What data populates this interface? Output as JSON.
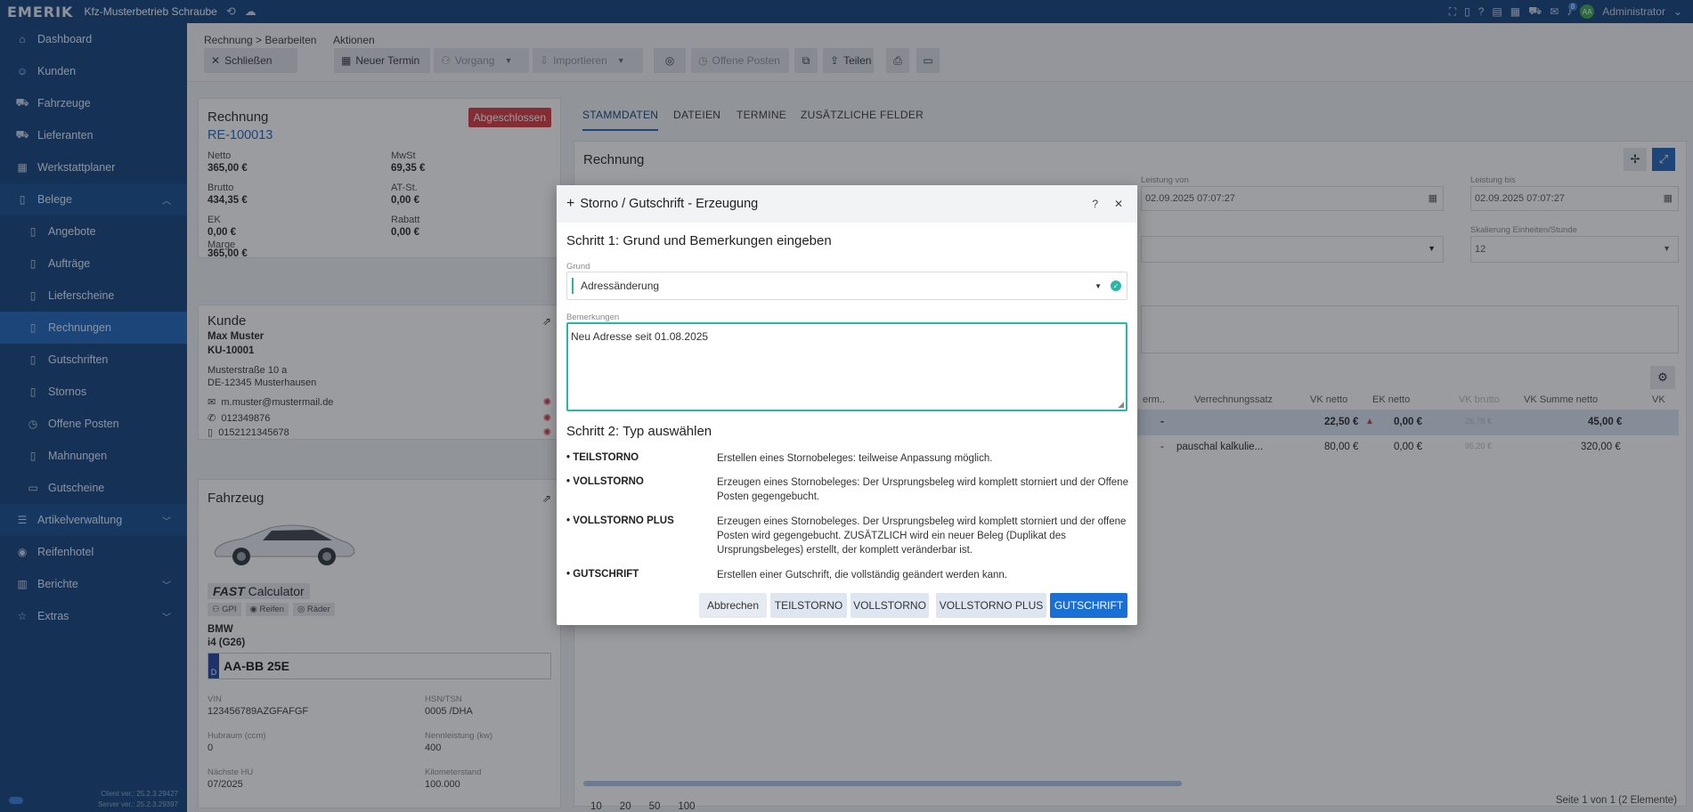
{
  "topbar": {
    "logo": "EMERIK",
    "company": "Kfz-Musterbetrieb Schraube",
    "user": "Administrator",
    "avatar": "AA",
    "notif_count": "8"
  },
  "sidebar": {
    "items": [
      {
        "label": "Dashboard",
        "icon": "home-icon"
      },
      {
        "label": "Kunden",
        "icon": "user-icon"
      },
      {
        "label": "Fahrzeuge",
        "icon": "car-icon"
      },
      {
        "label": "Lieferanten",
        "icon": "truck-icon"
      },
      {
        "label": "Werkstattplaner",
        "icon": "calendar-icon"
      },
      {
        "label": "Belege",
        "icon": "document-icon"
      },
      {
        "label": "Angebote",
        "icon": "document-icon"
      },
      {
        "label": "Aufträge",
        "icon": "document-icon"
      },
      {
        "label": "Lieferscheine",
        "icon": "document-icon"
      },
      {
        "label": "Rechnungen",
        "icon": "document-icon"
      },
      {
        "label": "Gutschriften",
        "icon": "document-icon"
      },
      {
        "label": "Stornos",
        "icon": "document-icon"
      },
      {
        "label": "Offene Posten",
        "icon": "clock-icon"
      },
      {
        "label": "Mahnungen",
        "icon": "document-icon"
      },
      {
        "label": "Gutscheine",
        "icon": "ticket-icon"
      },
      {
        "label": "Artikelverwaltung",
        "icon": "list-icon"
      },
      {
        "label": "Reifenhotel",
        "icon": "tire-icon"
      },
      {
        "label": "Berichte",
        "icon": "chart-icon"
      },
      {
        "label": "Extras",
        "icon": "star-icon"
      }
    ],
    "version_client": "Client ver.: 25.2.3.29427",
    "version_server": "Server ver.: 25.2.3.29397"
  },
  "toolbar": {
    "crumb": "Rechnung > Bearbeiten",
    "actions": "Aktionen",
    "close": "Schließen",
    "new_appt": "Neuer Termin",
    "process": "Vorgang",
    "import": "Importieren",
    "open_items": "Offene Posten",
    "share": "Teilen"
  },
  "invoice": {
    "title": "Rechnung",
    "number": "RE-100013",
    "status": "Abgeschlossen",
    "netto_label": "Netto",
    "netto": "365,00 €",
    "mwst_label": "MwSt",
    "mwst": "69,35 €",
    "brutto_label": "Brutto",
    "brutto": "434,35 €",
    "atst_label": "AT-St.",
    "atst": "0,00 €",
    "ek_label": "EK",
    "ek": "0,00 €",
    "rabatt_label": "Rabatt",
    "rabatt": "0,00 €",
    "marge_label": "Marge",
    "marge": "365,00 €"
  },
  "customer": {
    "title": "Kunde",
    "name": "Max Muster",
    "number": "KU-10001",
    "street": "Musterstraße 10 a",
    "city": "DE-12345 Musterhausen",
    "email": "m.muster@mustermail.de",
    "phone": "012349876",
    "mobile": "0152121345678"
  },
  "vehicle": {
    "title": "Fahrzeug",
    "calc_brand": "FAST",
    "calc_label": "Calculator",
    "chip_gpi": "GPI",
    "chip_tires": "Reifen",
    "chip_wheels": "Räder",
    "make": "BMW",
    "model": "i4 (G26)",
    "plate_country": "D",
    "plate": "AA-BB 25E",
    "vin_label": "VIN",
    "vin": "123456789AZGFAFGF",
    "hsn_label": "HSN/TSN",
    "hsn": "0005 /DHA",
    "cc_label": "Hubraum (ccm)",
    "cc": "0",
    "kw_label": "Nennleistung (kw)",
    "kw": "400",
    "hu_label": "Nächste HU",
    "hu": "07/2025",
    "km_label": "Kilometerstand",
    "km": "100.000"
  },
  "tabs": [
    "STAMMDATEN",
    "DATEIEN",
    "TERMINE",
    "ZUSÄTZLICHE FELDER"
  ],
  "detail": {
    "title": "Rechnung",
    "leistung_von_label": "Leistung von",
    "leistung_von": "02.09.2025 07:07:27",
    "leistung_bis_label": "Leistung bis",
    "leistung_bis": "02.09.2025 07:07:27",
    "skalierung_label": "Skalierung Einheiten/Stunde",
    "skalierung": "12"
  },
  "table": {
    "headers": [
      "erm..",
      "Verrechnungssatz",
      "VK netto",
      "EK netto",
      "VK brutto",
      "VK Summe netto",
      "VK"
    ],
    "rows": [
      {
        "erm": "-",
        "satz": "",
        "vk_netto": "22,50 €",
        "ek_netto": "0,00 €",
        "vk_brutto": "26,78 €",
        "vk_summe": "45,00 €"
      },
      {
        "erm": "-",
        "satz": "pauschal kalkulie...",
        "vk_netto": "80,00 €",
        "ek_netto": "0,00 €",
        "vk_brutto": "95,20 €",
        "vk_summe": "320,00 €"
      }
    ],
    "page_sizes": [
      "10",
      "20",
      "50",
      "100"
    ],
    "page_info": "Seite 1 von 1 (2 Elemente)"
  },
  "modal": {
    "title": "Storno / Gutschrift - Erzeugung",
    "step1": "Schritt 1: Grund und Bemerkungen eingeben",
    "grund_label": "Grund",
    "grund_value": "Adressänderung",
    "bemerkungen_label": "Bemerkungen",
    "bemerkungen_value": "Neu Adresse seit 01.08.2025",
    "step2": "Schritt 2: Typ auswählen",
    "types": [
      {
        "name": "• TEILSTORNO",
        "desc": "Erstellen eines Stornobeleges: teilweise Anpassung möglich."
      },
      {
        "name": "• VOLLSTORNO",
        "desc": "Erzeugen eines Stornobeleges: Der Ursprungsbeleg wird komplett storniert und der Offene Posten gegengebucht."
      },
      {
        "name": "• VOLLSTORNO PLUS",
        "desc": "Erzeugen eines Stornobeleges. Der Ursprungsbeleg wird komplett storniert und der offene Posten wird gegengebucht. ZUSÄTZLICH wird ein neuer Beleg (Duplikat des Ursprungsbeleges) erstellt, der komplett veränderbar ist."
      },
      {
        "name": "• GUTSCHRIFT",
        "desc": "Erstellen einer Gutschrift, die vollständig geändert werden kann."
      }
    ],
    "btn_cancel": "Abbrechen",
    "btn_teil": "TEILSTORNO",
    "btn_voll": "VOLLSTORNO",
    "btn_vollplus": "VOLLSTORNO PLUS",
    "btn_gutschrift": "GUTSCHRIFT"
  }
}
